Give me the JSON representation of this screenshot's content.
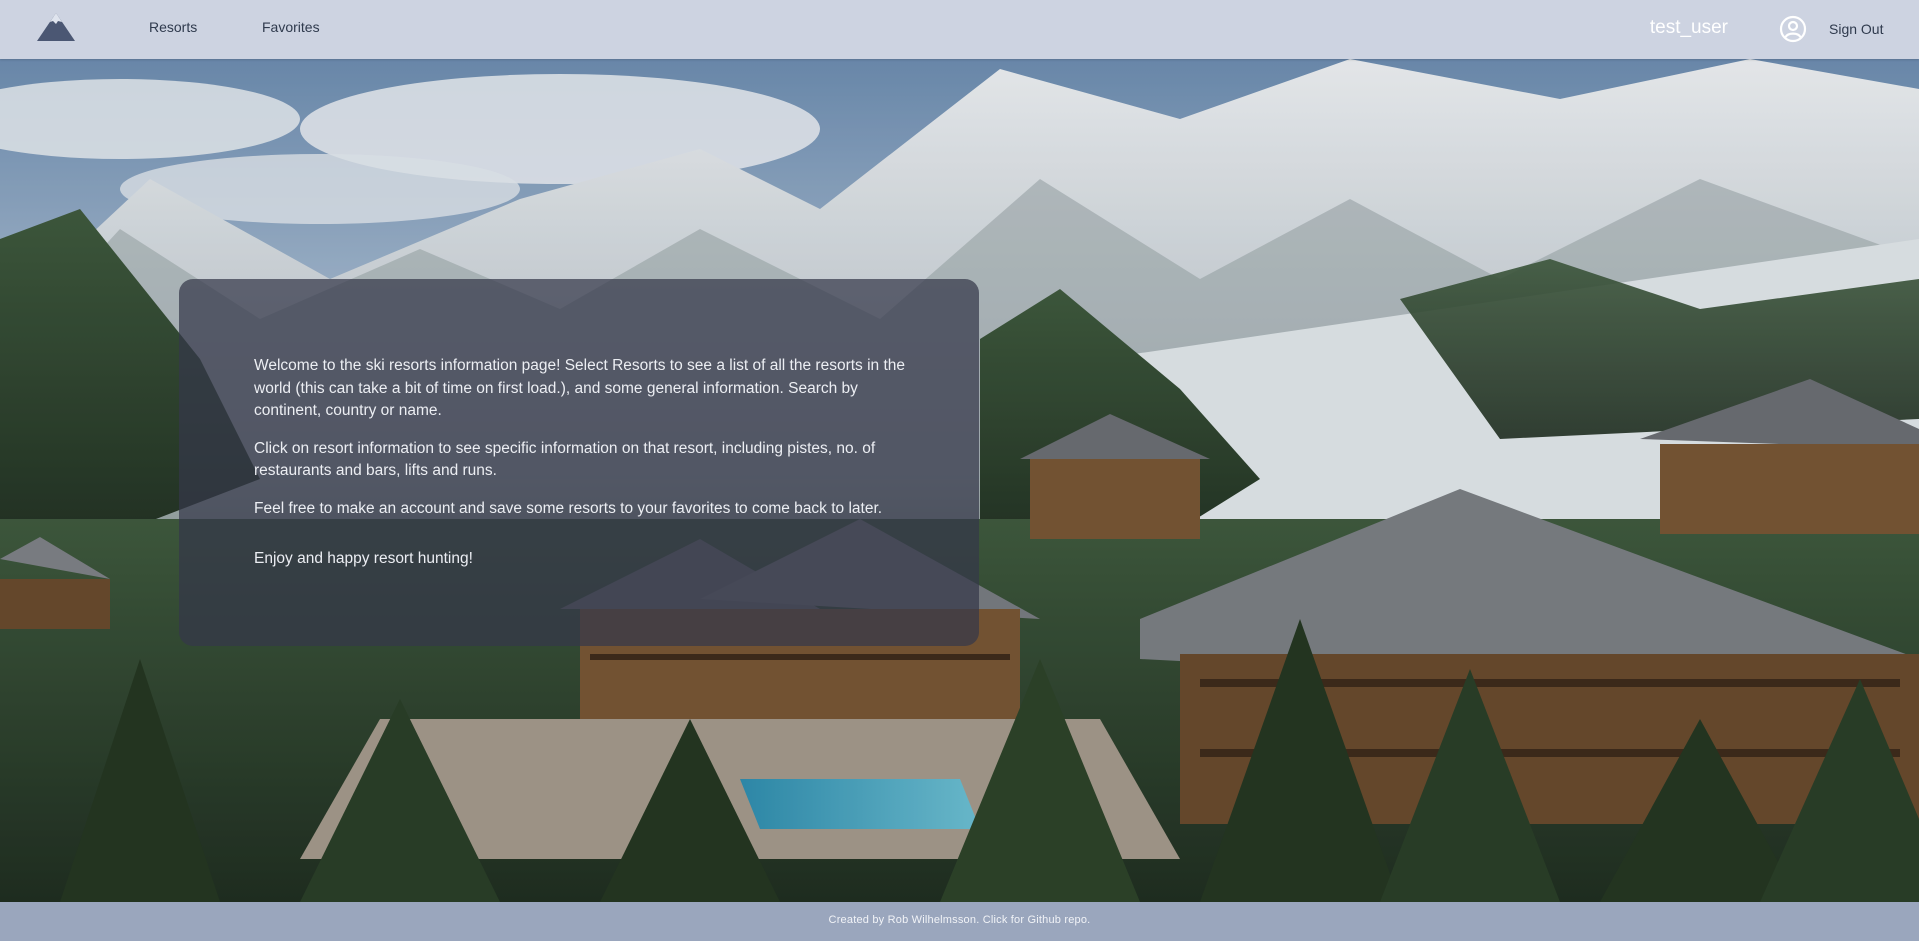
{
  "nav": {
    "logo_icon": "mountain-logo-icon",
    "links": [
      {
        "label": "Resorts"
      },
      {
        "label": "Favorites"
      }
    ],
    "username": "test_user",
    "user_icon": "user-circle-icon",
    "sign_out_label": "Sign Out"
  },
  "hero": {
    "paragraphs": [
      "Welcome to the ski resorts information page! Select Resorts to see a list of all the resorts in the world (this can take a bit of time on first load.), and some general information. Search by continent, country or name.",
      "Click on resort information to see specific information on that resort, including pistes, no. of restaurants and bars, lifts and runs.",
      "Feel free to make an account and save some resorts to your favorites to come back to later.",
      "Enjoy and happy resort hunting!"
    ]
  },
  "footer": {
    "text": "Created by Rob Wilhelmsson. Click for Github repo."
  },
  "colors": {
    "navbar_bg": "#cdd3e1",
    "footer_bg": "#9aa6bd",
    "card_bg": "rgba(52,56,74,0.72)"
  }
}
